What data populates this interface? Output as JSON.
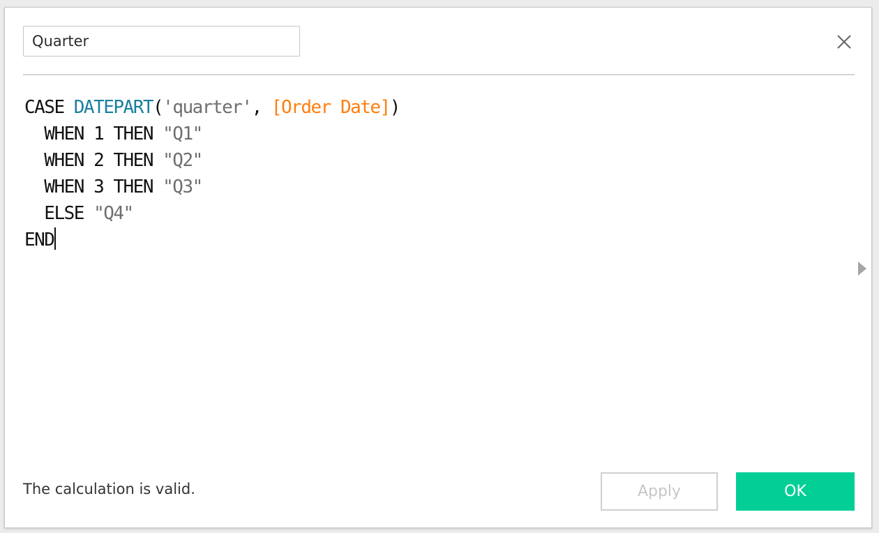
{
  "dialog": {
    "calc_name": "Quarter",
    "close_icon": "close-x-icon",
    "expand_icon": "triangle-right-icon"
  },
  "editor": {
    "lines": [
      [
        {
          "type": "kw",
          "text": "CASE "
        },
        {
          "type": "fn",
          "text": "DATEPART"
        },
        {
          "type": "punct",
          "text": "("
        },
        {
          "type": "str",
          "text": "'quarter'"
        },
        {
          "type": "punct",
          "text": ", "
        },
        {
          "type": "field",
          "text": "[Order Date]"
        },
        {
          "type": "punct",
          "text": ")"
        }
      ],
      [
        {
          "type": "kw",
          "text": "  WHEN 1 THEN "
        },
        {
          "type": "str",
          "text": "\"Q1\""
        }
      ],
      [
        {
          "type": "kw",
          "text": "  WHEN 2 THEN "
        },
        {
          "type": "str",
          "text": "\"Q2\""
        }
      ],
      [
        {
          "type": "kw",
          "text": "  WHEN 3 THEN "
        },
        {
          "type": "str",
          "text": "\"Q3\""
        }
      ],
      [
        {
          "type": "kw",
          "text": "  ELSE "
        },
        {
          "type": "str",
          "text": "\"Q4\""
        }
      ],
      [
        {
          "type": "kw",
          "text": "END"
        }
      ]
    ],
    "colors": {
      "keyword": "#111111",
      "function": "#1a7fa0",
      "string": "#6f6f6f",
      "field": "#ff7f0e"
    }
  },
  "footer": {
    "status_text": "The calculation is valid.",
    "apply_label": "Apply",
    "ok_label": "OK",
    "ok_color": "#02cf96"
  }
}
